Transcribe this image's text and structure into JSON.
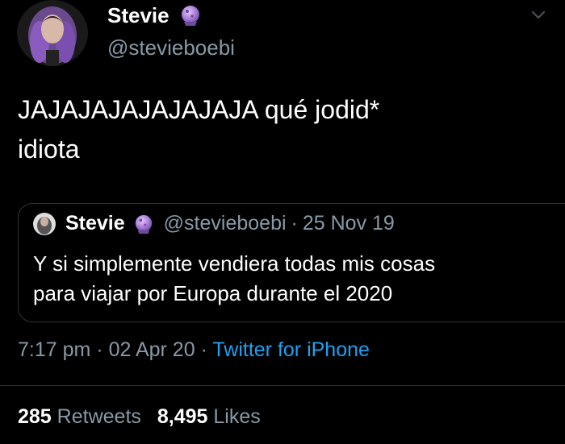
{
  "author": {
    "display_name": "Stevie",
    "handle": "@stevieboebi",
    "emoji_icon": "crystal-ball-icon"
  },
  "tweet": {
    "text_line1": "JAJAJAJAJAJAJAJA qué jodid*",
    "text_line2": "idiota"
  },
  "quoted_tweet": {
    "display_name": "Stevie",
    "handle": "@stevieboebi",
    "separator": "·",
    "date": "25 Nov 19",
    "text_line1": "Y si simplemente vendiera todas mis cosas",
    "text_line2": "para viajar por Europa durante el 2020"
  },
  "meta": {
    "time": "7:17 pm",
    "separator": "·",
    "date": "02 Apr 20",
    "source": "Twitter for iPhone"
  },
  "stats": {
    "retweets_count": "285",
    "retweets_label": "Retweets",
    "likes_count": "8,495",
    "likes_label": "Likes"
  },
  "colors": {
    "background": "#000000",
    "text": "#ffffff",
    "secondary": "#8899a6",
    "link": "#1da1f2",
    "border": "#2f3336"
  }
}
